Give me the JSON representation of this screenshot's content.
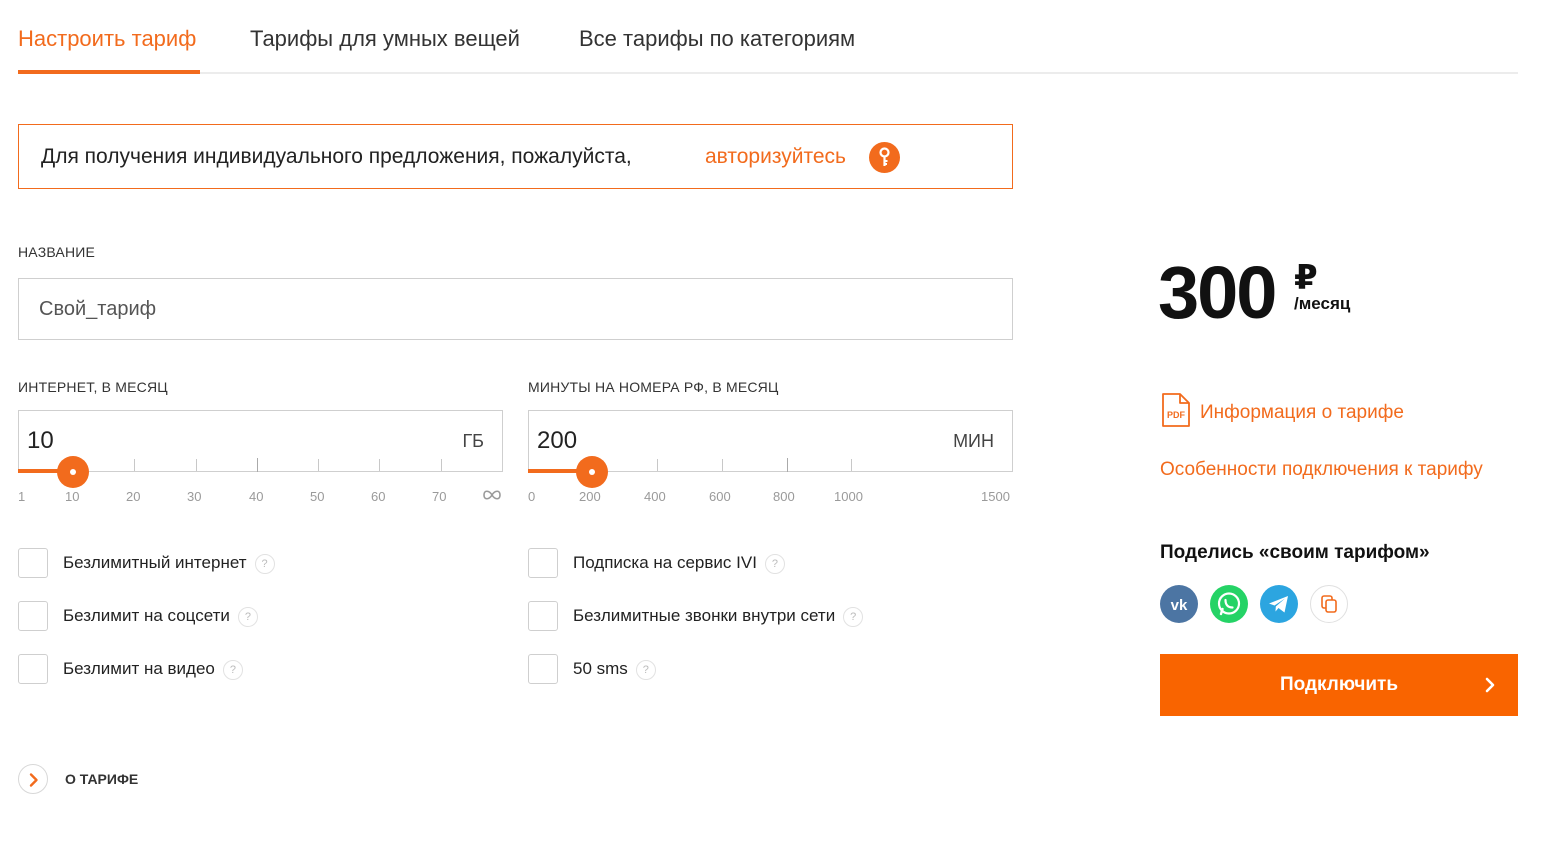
{
  "tabs": [
    {
      "label": "Настроить тариф",
      "active": true
    },
    {
      "label": "Тарифы для умных вещей",
      "active": false
    },
    {
      "label": "Все тарифы по категориям",
      "active": false
    }
  ],
  "alert": {
    "text": "Для получения индивидуального предложения, пожалуйста,",
    "link": "авторизуйтесь",
    "icon": "key-icon"
  },
  "name": {
    "label": "НАЗВАНИЕ",
    "value": "Свой_тариф"
  },
  "internet": {
    "label": "ИНТЕРНЕТ, В МЕСЯЦ",
    "value": "10",
    "unit": "ГБ",
    "ticks": [
      "1",
      "10",
      "20",
      "30",
      "40",
      "50",
      "60",
      "70"
    ],
    "max_icon": "infinity-icon"
  },
  "minutes": {
    "label": "МИНУТЫ НА НОМЕРА РФ, В МЕСЯЦ",
    "value": "200",
    "unit": "МИН",
    "ticks": [
      "0",
      "200",
      "400",
      "600",
      "800",
      "1000",
      "1500"
    ]
  },
  "options_left": [
    "Безлимитный интернет",
    "Безлимит на соцсети",
    "Безлимит на видео"
  ],
  "options_right": [
    "Подписка на сервис IVI",
    "Безлимитные звонки внутри сети",
    "50 sms"
  ],
  "help_glyph": "?",
  "about": {
    "label": "О ТАРИФЕ"
  },
  "price": {
    "amount": "300",
    "currency": "₽",
    "period": "/месяц"
  },
  "links": {
    "info": "Информация о тарифе",
    "features": "Особенности подключения к тарифу"
  },
  "share": {
    "title": "Поделись «своим тарифом»",
    "icons": [
      "vk-icon",
      "whatsapp-icon",
      "telegram-icon",
      "copy-icon"
    ]
  },
  "connect_button": "Подключить",
  "colors": {
    "accent": "#f26b1d",
    "button": "#f96400",
    "vk": "#4c75a3",
    "whatsapp": "#25d366",
    "telegram": "#2ca5e0"
  }
}
